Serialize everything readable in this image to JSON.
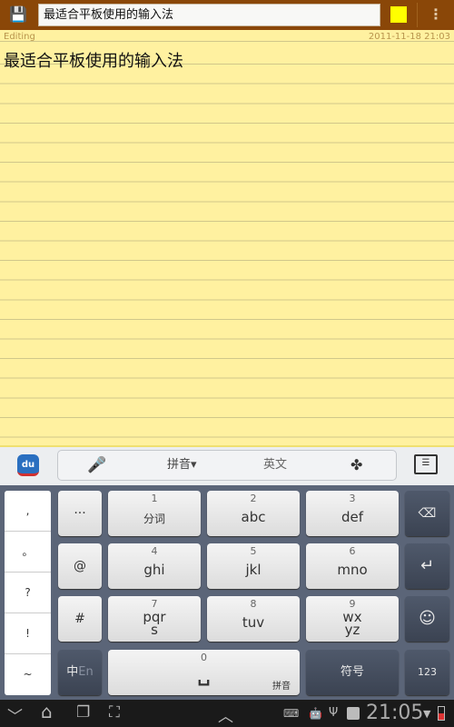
{
  "topbar": {
    "save_icon": "save-icon",
    "title": "最适合平板使用的输入法",
    "note_color": "#ffff00",
    "menu_icon": "overflow-menu-icon"
  },
  "note": {
    "status": "Editing",
    "date": "2011-11-18 21:03",
    "body": "最适合平板使用的输入法",
    "background": "#fff1a0"
  },
  "keyboard_toolbar": {
    "logo": "du",
    "mic_icon": "microphone-icon",
    "pinyin": "拼音▾",
    "english": "英文",
    "clover_icon": "clover-icon",
    "hide_icon": "hide-keyboard-icon"
  },
  "candidates": [
    ",",
    "。",
    "?",
    "!",
    "~"
  ],
  "keys": {
    "row1": {
      "left": "···",
      "k1": {
        "num": "1",
        "label": "分词"
      },
      "k2": {
        "num": "2",
        "label": "abc"
      },
      "k3": {
        "num": "3",
        "label": "def"
      },
      "right": "⌫"
    },
    "row2": {
      "left": "@",
      "k1": {
        "num": "4",
        "label": "ghi"
      },
      "k2": {
        "num": "5",
        "label": "jkl"
      },
      "k3": {
        "num": "6",
        "label": "mno"
      },
      "right": "↵"
    },
    "row3": {
      "left": "#",
      "k1": {
        "num": "7",
        "label": "pqrs"
      },
      "k2": {
        "num": "8",
        "label": "tuv"
      },
      "k3": {
        "num": "9",
        "label": "wxyz"
      },
      "right": "☺"
    },
    "row4": {
      "lang_zh": "中",
      "lang_en": "En",
      "space_num": "0",
      "space_symbol": "␣",
      "space_hint": "拼音",
      "symbols": "符号",
      "numbers": "123"
    }
  },
  "navbar": {
    "back": "﹀",
    "home": "⌂",
    "recent": "❐",
    "screenshot": "⛶",
    "up": "︿",
    "clock": "21:05"
  }
}
